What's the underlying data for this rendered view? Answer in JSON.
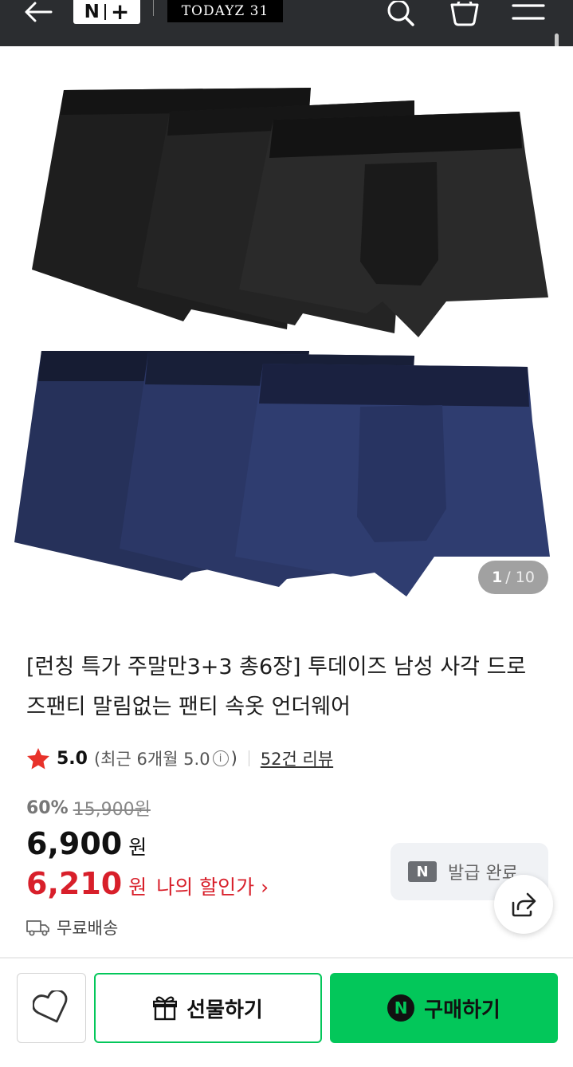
{
  "header": {
    "logo_n": "N",
    "logo_plus": "+",
    "store_name": "TODAYZ 31",
    "icons": [
      "back-arrow-icon",
      "search-icon",
      "cart-icon",
      "menu-icon"
    ]
  },
  "gallery": {
    "current": "1",
    "total": "/ 10",
    "image": "product-photo-black-and-navy-boxer-briefs"
  },
  "product": {
    "title": "[런칭 특가 주말만3+3 총6장] 투데이즈 남성 사각 드로즈팬티 말림없는 팬티 속옷 언더웨어",
    "rating": "5.0",
    "recent_prefix": "(최근 6개월 5.0",
    "info_glyph": "i",
    "recent_suffix": ")",
    "reviews": "52건 리뷰",
    "discount_pct": "60%",
    "original_price": "15,900원",
    "price": "6,900",
    "price_unit": "원",
    "my_price": "6,210",
    "my_price_unit": "원",
    "my_price_label": "나의 할인가",
    "my_price_chevron": "›",
    "shipping": "무료배송"
  },
  "coupon": {
    "badge": "N",
    "label": "발급 완료"
  },
  "actions": {
    "gift": "선물하기",
    "buy_badge": "N",
    "buy": "구매하기"
  },
  "colors": {
    "header_bg": "#2b2d30",
    "naver_green": "#03c75a",
    "discount_red": "#d81f2a",
    "star": "#e8322a"
  }
}
